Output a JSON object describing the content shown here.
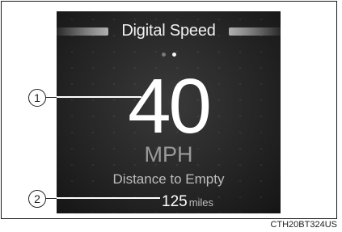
{
  "screen": {
    "title": "Digital Speed",
    "speed": {
      "value": "40",
      "unit": "MPH"
    },
    "distance_to_empty": {
      "label": "Distance to Empty",
      "value": "125",
      "unit": "miles"
    },
    "pager": {
      "total": 2,
      "active_index": 1
    }
  },
  "callouts": {
    "one": "1",
    "two": "2"
  },
  "caption": "CTH20BT324US"
}
